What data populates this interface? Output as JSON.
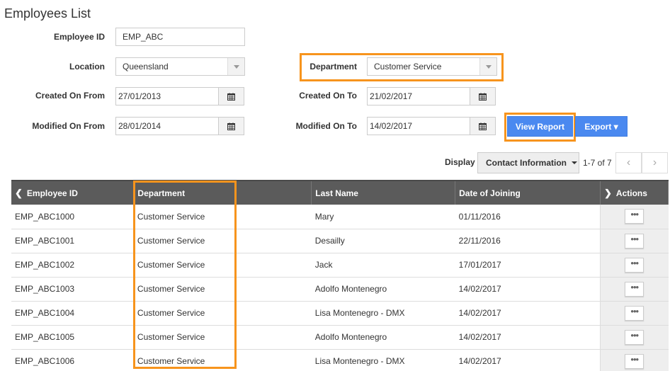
{
  "page": {
    "title": "Employees List"
  },
  "filters": {
    "employee_id": {
      "label": "Employee ID",
      "value": "EMP_ABC"
    },
    "location": {
      "label": "Location",
      "value": "Queensland"
    },
    "department": {
      "label": "Department",
      "value": "Customer Service"
    },
    "created_on_from": {
      "label": "Created On From",
      "value": "27/01/2013"
    },
    "created_on_to": {
      "label": "Created On To",
      "value": "21/02/2017"
    },
    "modified_on_from": {
      "label": "Modified On From",
      "value": "28/01/2014"
    },
    "modified_on_to": {
      "label": "Modified On To",
      "value": "14/02/2017"
    }
  },
  "buttons": {
    "view_report": "View Report",
    "export": "Export ▾"
  },
  "display": {
    "label": "Display",
    "value": "Contact Information",
    "pagination": "1-7 of 7",
    "prev": "‹",
    "next": "›"
  },
  "colors": {
    "primary": "#4a89f0",
    "highlight": "#f7941d",
    "header_bg": "#5b5b5b"
  },
  "table": {
    "columns": [
      "Employee ID",
      "Department",
      "Last Name",
      "Date of Joining",
      "Actions"
    ],
    "rows": [
      {
        "id": "EMP_ABC1000",
        "dept": "Customer Service",
        "last": "Mary",
        "doj": "01/11/2016"
      },
      {
        "id": "EMP_ABC1001",
        "dept": "Customer Service",
        "last": "Desailly",
        "doj": "22/11/2016"
      },
      {
        "id": "EMP_ABC1002",
        "dept": "Customer Service",
        "last": "Jack",
        "doj": "17/01/2017"
      },
      {
        "id": "EMP_ABC1003",
        "dept": "Customer Service",
        "last": "Adolfo Montenegro",
        "doj": "14/02/2017"
      },
      {
        "id": "EMP_ABC1004",
        "dept": "Customer Service",
        "last": "Lisa Montenegro - DMX",
        "doj": "14/02/2017"
      },
      {
        "id": "EMP_ABC1005",
        "dept": "Customer Service",
        "last": "Adolfo Montenegro",
        "doj": "14/02/2017"
      },
      {
        "id": "EMP_ABC1006",
        "dept": "Customer Service",
        "last": "Lisa Montenegro - DMX",
        "doj": "14/02/2017"
      }
    ],
    "action_label": "•••"
  }
}
